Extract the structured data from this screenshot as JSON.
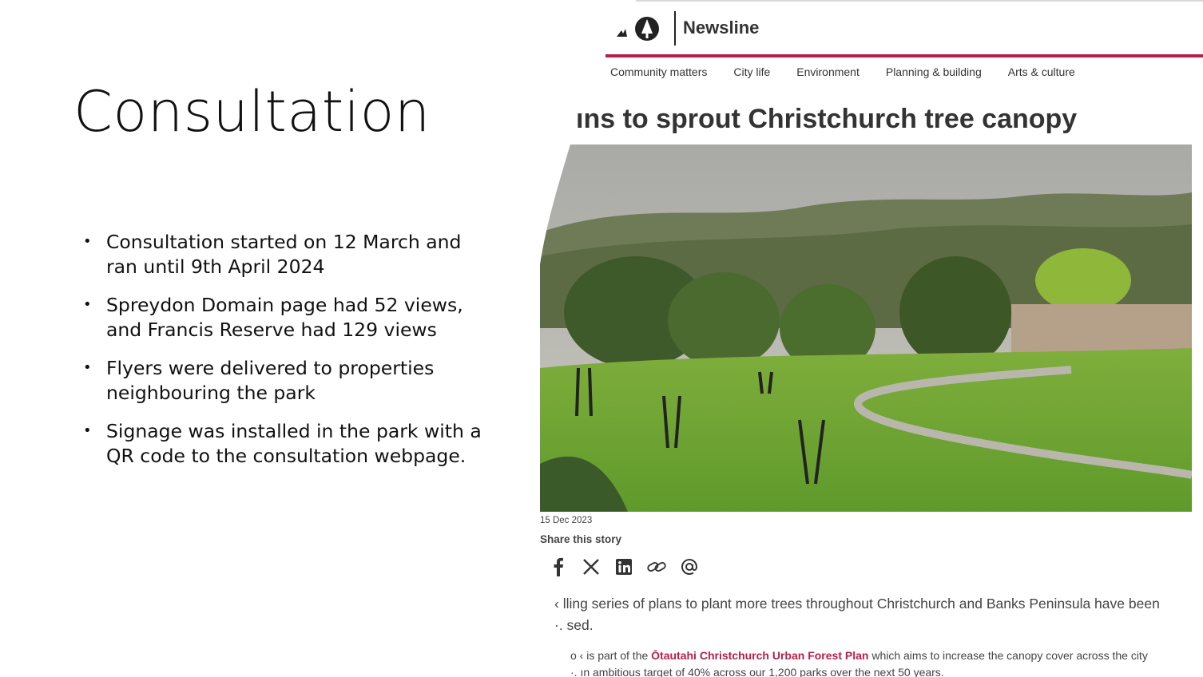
{
  "slide": {
    "title": "Consultation",
    "bullets": [
      "Consultation started on 12 March and ran until 9th April 2024",
      "Spreydon Domain page had 52 views, and Francis  Reserve had  129 views",
      "Flyers were delivered to properties neighbouring the park",
      "Signage was installed in the park with a QR code to the consultation webpage."
    ]
  },
  "screenshot": {
    "brand": "Newsline",
    "nav": [
      "Community matters",
      "City life",
      "Environment",
      "Planning & building",
      "Arts & culture"
    ],
    "headline": "ıns to sprout Christchurch tree canopy",
    "date": "15 Dec 2023",
    "share_label": "Share this story",
    "social_icons": [
      "facebook-icon",
      "x-icon",
      "linkedin-icon",
      "link-icon",
      "email-icon"
    ],
    "para1": "‹ lling series of plans to plant more trees throughout Christchurch and Banks Peninsula have been\n·. sed.",
    "para2_pre": "o ‹ is part of the ",
    "para2_link": "Ōtautahi Christchurch Urban Forest Plan",
    "para2_post": " which aims to increase the canopy cover across the city",
    "para2_line2": "·. ın ambitious target of 40%  across our 1,200 parks over the next 50 years.",
    "colors": {
      "accent": "#b5204a",
      "text": "#333333"
    }
  }
}
